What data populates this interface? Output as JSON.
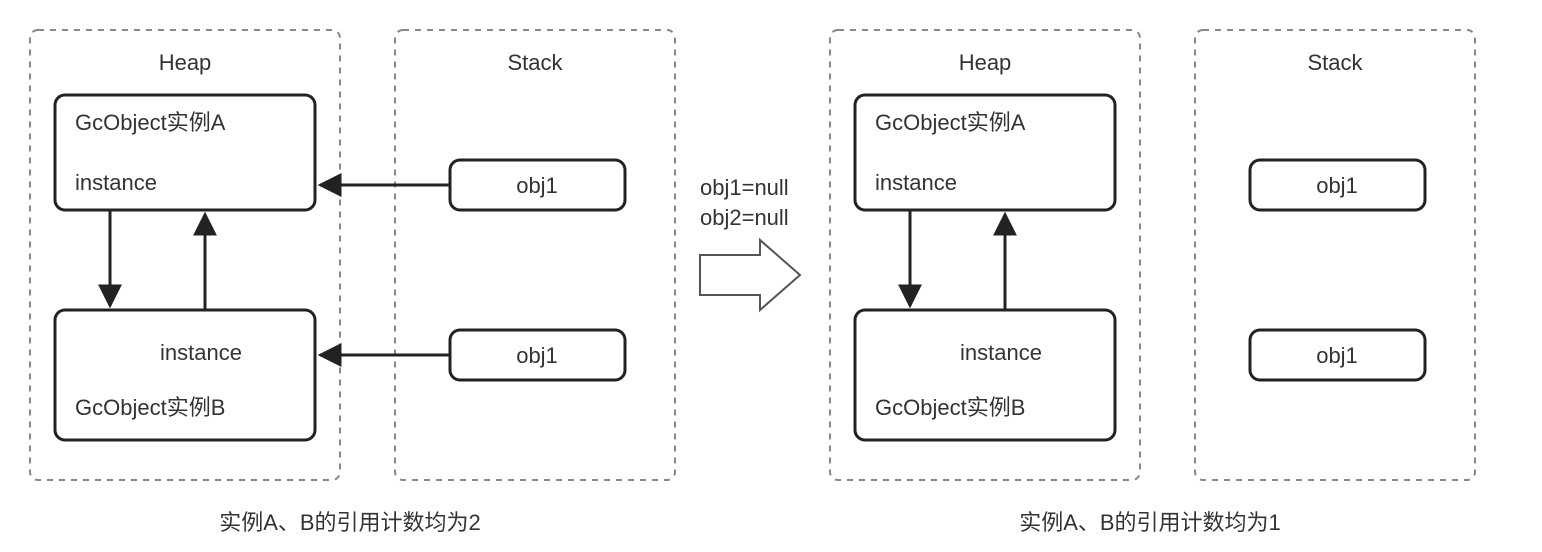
{
  "left": {
    "heapTitle": "Heap",
    "stackTitle": "Stack",
    "objA": {
      "title": "GcObject实例A",
      "field": "instance"
    },
    "objB": {
      "title": "GcObject实例B",
      "field": "instance"
    },
    "stackVar1": "obj1",
    "stackVar2": "obj1",
    "caption": "实例A、B的引用计数均为2"
  },
  "transition": {
    "line1": "obj1=null",
    "line2": "obj2=null"
  },
  "right": {
    "heapTitle": "Heap",
    "stackTitle": "Stack",
    "objA": {
      "title": "GcObject实例A",
      "field": "instance"
    },
    "objB": {
      "title": "GcObject实例B",
      "field": "instance"
    },
    "stackVar1": "obj1",
    "stackVar2": "obj1",
    "caption": "实例A、B的引用计数均为1"
  }
}
